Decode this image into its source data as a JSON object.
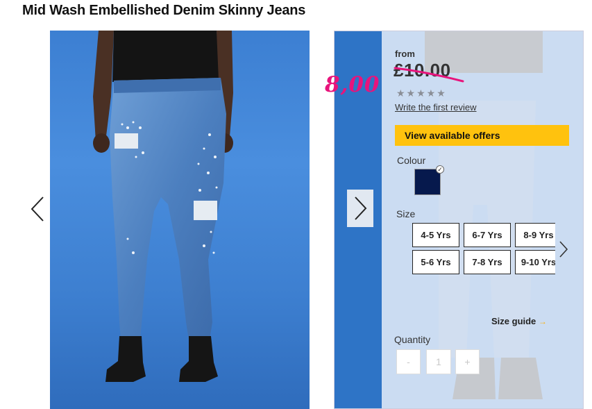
{
  "product": {
    "title": "Mid Wash Embellished Denim Skinny Jeans"
  },
  "pricing": {
    "from_label": "from",
    "old_price": "£10.00",
    "new_price": "8,00",
    "strike_color": "#e8147c"
  },
  "reviews": {
    "stars": "★★★★★",
    "rating": 0,
    "link_text": "Write the first review"
  },
  "offers": {
    "button_label": "View available offers",
    "button_color": "#ffc20e"
  },
  "colour": {
    "label": "Colour",
    "selected_swatch": "#06194d"
  },
  "size": {
    "label": "Size",
    "options": [
      "4-5 Yrs",
      "6-7 Yrs",
      "8-9 Yrs",
      "5-6 Yrs",
      "7-8 Yrs",
      "9-10 Yrs"
    ],
    "guide_label": "Size guide",
    "guide_arrow": "→"
  },
  "quantity": {
    "label": "Quantity",
    "minus": "-",
    "value": "1",
    "plus": "+"
  },
  "icons": {
    "gallery_prev": "chevron-left-icon",
    "gallery_next": "chevron-right-icon",
    "size_next": "chevron-right-icon",
    "swatch_selected": "check-icon"
  }
}
